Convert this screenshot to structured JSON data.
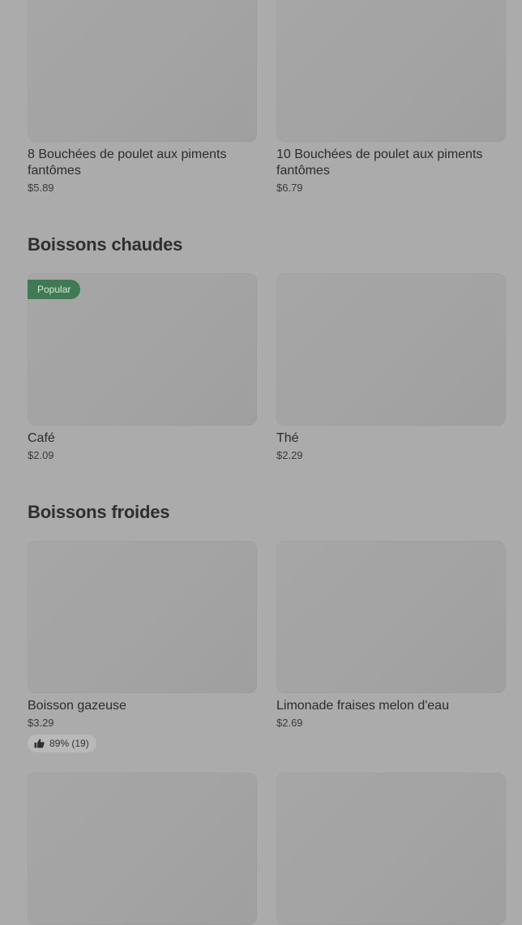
{
  "sections": [
    {
      "title": "",
      "items": [
        {
          "name": "8 Bouchées de poulet aux piments fantômes",
          "price": "$5.89"
        },
        {
          "name": "10 Bouchées de poulet aux piments fantômes",
          "price": "$6.79"
        }
      ]
    },
    {
      "title": "Boissons chaudes",
      "items": [
        {
          "name": "Café",
          "price": "$2.09",
          "badge": "Popular"
        },
        {
          "name": "Thé",
          "price": "$2.29"
        }
      ]
    },
    {
      "title": "Boissons froides",
      "items": [
        {
          "name": "Boisson gazeuse",
          "price": "$3.29",
          "rating": "89% (19)"
        },
        {
          "name": "Limonade fraises melon d'eau",
          "price": "$2.69"
        },
        {
          "name": "",
          "price": ""
        },
        {
          "name": "",
          "price": ""
        }
      ]
    }
  ],
  "icons": {
    "rating": "thumbs-up-icon"
  },
  "colors": {
    "background": "#ababab",
    "image_placeholder": "#a4a4a4",
    "badge": "#3f7a54",
    "text": "#2c2c2c"
  }
}
